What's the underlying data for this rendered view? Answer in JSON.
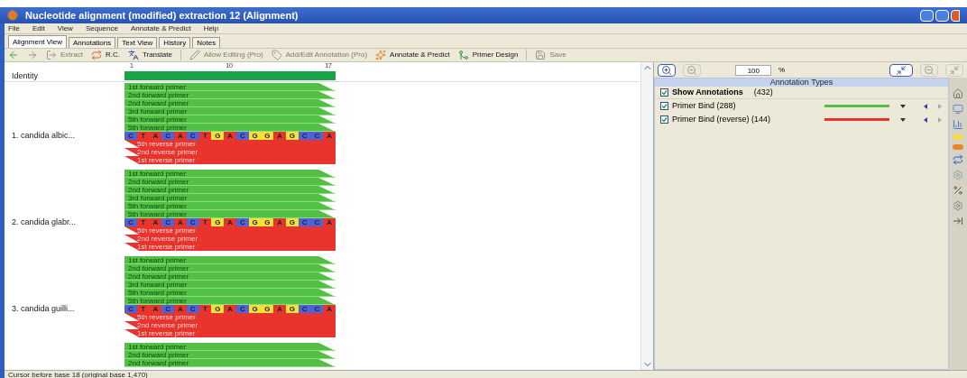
{
  "window": {
    "title": "Nucleotide alignment (modified) extraction 12 (Alignment)"
  },
  "menu": [
    "File",
    "Edit",
    "View",
    "Sequence",
    "Annotate & Predict",
    "Help"
  ],
  "tabs": [
    {
      "label": "Alignment View",
      "selected": true
    },
    {
      "label": "Annotations",
      "selected": false
    },
    {
      "label": "Text View",
      "selected": false
    },
    {
      "label": "History",
      "selected": false
    },
    {
      "label": "Notes",
      "selected": false
    }
  ],
  "toolbar": [
    {
      "kind": "back",
      "disabled": false
    },
    {
      "kind": "forward",
      "disabled": true
    },
    {
      "kind": "extract",
      "label": "Extract",
      "disabled": true
    },
    {
      "kind": "rc",
      "label": "R.C.",
      "disabled": false
    },
    {
      "kind": "translate",
      "label": "Translate",
      "disabled": false
    },
    {
      "kind": "separator"
    },
    {
      "kind": "edit",
      "label": "Allow Editing (Pro)",
      "disabled": true
    },
    {
      "kind": "annotation",
      "label": "Add/Edit Annotation (Pro)",
      "disabled": true
    },
    {
      "kind": "predict",
      "label": "Annotate & Predict",
      "disabled": false
    },
    {
      "kind": "primer",
      "label": "Primer Design",
      "disabled": false
    },
    {
      "kind": "separator"
    },
    {
      "kind": "save",
      "label": "Save",
      "disabled": true
    }
  ],
  "ruler": {
    "ticks": [
      "1",
      "10",
      "17"
    ]
  },
  "identity": {
    "label": "Identity",
    "level": 1
  },
  "sequences": [
    {
      "name": "1. candida albic...",
      "forward": [
        "1st forward primer",
        "2nd forward primer",
        "2nd forward primer",
        "3rd forward primer",
        "5th forward primer",
        "5th forward primer"
      ],
      "bases": [
        {
          "base": "C",
          "color": "#4f63d8"
        },
        {
          "base": "T",
          "color": "#e8342c"
        },
        {
          "base": "A",
          "color": "#e8342c"
        },
        {
          "base": "C",
          "color": "#4f63d8"
        },
        {
          "base": "A",
          "color": "#e8342c"
        },
        {
          "base": "C",
          "color": "#4f63d8"
        },
        {
          "base": "T",
          "color": "#e8342c"
        },
        {
          "base": "G",
          "color": "#f3e23a"
        },
        {
          "base": "A",
          "color": "#e8342c"
        },
        {
          "base": "C",
          "color": "#4f63d8"
        },
        {
          "base": "G",
          "color": "#f3e23a"
        },
        {
          "base": "G",
          "color": "#f3e23a"
        },
        {
          "base": "A",
          "color": "#e8342c"
        },
        {
          "base": "G",
          "color": "#f3e23a"
        },
        {
          "base": "C",
          "color": "#4f63d8"
        },
        {
          "base": "C",
          "color": "#4f63d8"
        },
        {
          "base": "A",
          "color": "#e8342c"
        }
      ],
      "reverse": [
        "5th reverse primer",
        "2nd reverse primer",
        "1st reverse primer"
      ]
    },
    {
      "name": "2. candida glabr...",
      "forward": [
        "1st forward primer",
        "2nd forward primer",
        "2nd forward primer",
        "3rd forward primer",
        "5th forward primer",
        "5th forward primer"
      ],
      "bases": [
        {
          "base": "C",
          "color": "#4f63d8"
        },
        {
          "base": "T",
          "color": "#e8342c"
        },
        {
          "base": "A",
          "color": "#e8342c"
        },
        {
          "base": "C",
          "color": "#4f63d8"
        },
        {
          "base": "A",
          "color": "#e8342c"
        },
        {
          "base": "C",
          "color": "#4f63d8"
        },
        {
          "base": "T",
          "color": "#e8342c"
        },
        {
          "base": "G",
          "color": "#f3e23a"
        },
        {
          "base": "A",
          "color": "#e8342c"
        },
        {
          "base": "C",
          "color": "#4f63d8"
        },
        {
          "base": "G",
          "color": "#f3e23a"
        },
        {
          "base": "G",
          "color": "#f3e23a"
        },
        {
          "base": "A",
          "color": "#e8342c"
        },
        {
          "base": "G",
          "color": "#f3e23a"
        },
        {
          "base": "C",
          "color": "#4f63d8"
        },
        {
          "base": "C",
          "color": "#4f63d8"
        },
        {
          "base": "A",
          "color": "#e8342c"
        }
      ],
      "reverse": [
        "5th reverse primer",
        "2nd reverse primer",
        "1st reverse primer"
      ]
    },
    {
      "name": "3. candida guilli...",
      "forward": [
        "1st forward primer",
        "2nd forward primer",
        "2nd forward primer",
        "3rd forward primer",
        "5th forward primer",
        "5th forward primer"
      ],
      "bases": [
        {
          "base": "C",
          "color": "#4f63d8"
        },
        {
          "base": "T",
          "color": "#e8342c"
        },
        {
          "base": "A",
          "color": "#e8342c"
        },
        {
          "base": "C",
          "color": "#4f63d8"
        },
        {
          "base": "A",
          "color": "#e8342c"
        },
        {
          "base": "C",
          "color": "#4f63d8"
        },
        {
          "base": "T",
          "color": "#e8342c"
        },
        {
          "base": "G",
          "color": "#f3e23a"
        },
        {
          "base": "A",
          "color": "#e8342c"
        },
        {
          "base": "C",
          "color": "#4f63d8"
        },
        {
          "base": "G",
          "color": "#f3e23a"
        },
        {
          "base": "G",
          "color": "#f3e23a"
        },
        {
          "base": "A",
          "color": "#e8342c"
        },
        {
          "base": "G",
          "color": "#f3e23a"
        },
        {
          "base": "C",
          "color": "#4f63d8"
        },
        {
          "base": "C",
          "color": "#4f63d8"
        },
        {
          "base": "A",
          "color": "#e8342c"
        }
      ],
      "reverse": [
        "5th reverse primer",
        "2nd reverse primer",
        "1st reverse primer"
      ]
    },
    {
      "forward": [
        "1st forward primer",
        "2nd forward primer",
        "2nd forward primer"
      ]
    }
  ],
  "zoom": {
    "value": "100",
    "unit": "%"
  },
  "annotations": {
    "header": "Annotation Types",
    "show": {
      "label": "Show Annotations",
      "count": "(432)",
      "checked": true
    },
    "types": [
      {
        "label": "Primer Bind (288)",
        "checked": true,
        "color": "#52c042"
      },
      {
        "label": "Primer Bind (reverse) (144)",
        "checked": true,
        "color": "#e8342c"
      }
    ]
  },
  "status_bar": "Cursor before base 18 (original base 1,470)"
}
